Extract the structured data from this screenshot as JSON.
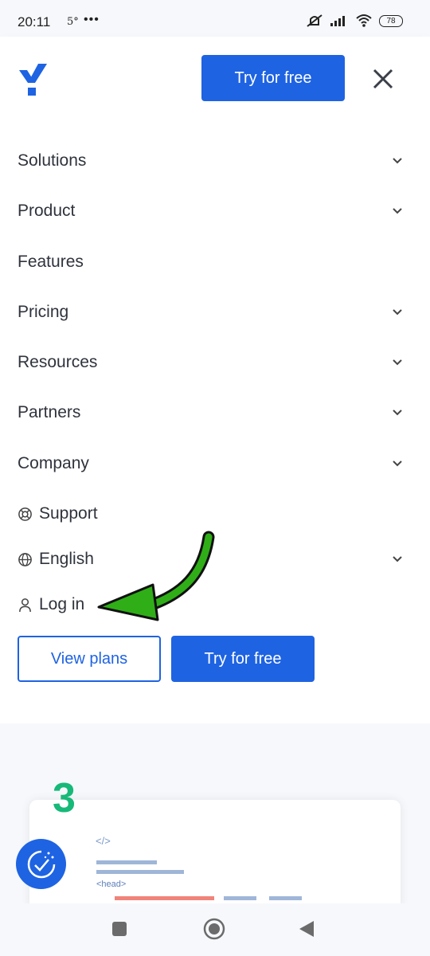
{
  "status": {
    "time": "20:11",
    "small": "5°",
    "dots": "•••",
    "battery": "78"
  },
  "header": {
    "cta": "Try for free"
  },
  "menu": [
    {
      "label": "Solutions",
      "chevron": true
    },
    {
      "label": "Product",
      "chevron": true
    },
    {
      "label": "Features",
      "chevron": false
    },
    {
      "label": "Pricing",
      "chevron": true
    },
    {
      "label": "Resources",
      "chevron": true
    },
    {
      "label": "Partners",
      "chevron": true
    },
    {
      "label": "Company",
      "chevron": true
    }
  ],
  "support": {
    "label": "Support"
  },
  "language": {
    "label": "English"
  },
  "login": {
    "label": "Log in"
  },
  "buttons": {
    "view_plans": "View plans",
    "try_free": "Try for free"
  },
  "content": {
    "step_number": "3",
    "code_tag": "</>",
    "head_tag": "<head>"
  },
  "colors": {
    "primary": "#1e63e2",
    "annotation_arrow": "#2fae18",
    "step_number": "#17b978"
  }
}
